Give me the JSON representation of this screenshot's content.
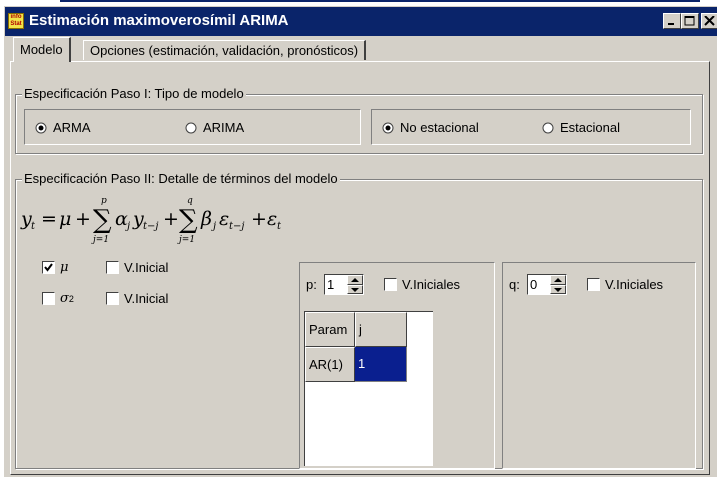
{
  "window": {
    "title": "Estimación maximoverosímil ARIMA",
    "icon": "app-icon",
    "accent": "#0a246a",
    "face": "#d4d0c8"
  },
  "tabs": [
    {
      "label": "Modelo",
      "active": true
    },
    {
      "label": "Opciones (estimación, validación, pronósticos)",
      "active": false
    }
  ],
  "step1": {
    "title": "Especificación Paso I: Tipo de modelo",
    "model_type": [
      {
        "label": "ARMA",
        "selected": true
      },
      {
        "label": "ARIMA",
        "selected": false
      }
    ],
    "seasonality": [
      {
        "label": "No estacional",
        "selected": true
      },
      {
        "label": "Estacional",
        "selected": false
      }
    ]
  },
  "step2": {
    "title": "Especificación Paso II: Detalle de términos del modelo",
    "mu": {
      "symbol": "μ",
      "checked": true,
      "initial_label": "V.Inicial",
      "initial_checked": false
    },
    "sigma": {
      "symbol": "σ",
      "superscript": "2",
      "checked": false,
      "initial_label": "V.Inicial",
      "initial_checked": false
    },
    "p_section": {
      "label": "p:",
      "value": "1",
      "initial_label": "V.Iniciales",
      "initial_checked": false,
      "grid": {
        "headers": [
          "Param",
          "j"
        ],
        "rows": [
          {
            "param": "AR(1)",
            "value": "1"
          }
        ]
      }
    },
    "q_section": {
      "label": "q:",
      "value": "0",
      "initial_label": "V.Iniciales",
      "initial_checked": false
    }
  }
}
